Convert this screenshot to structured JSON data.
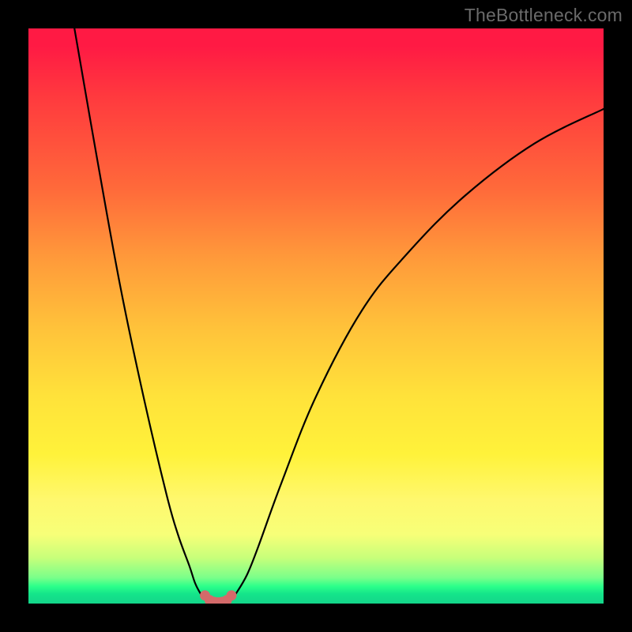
{
  "watermark": "TheBottleneck.com",
  "colors": {
    "frame": "#000000",
    "curve_stroke": "#000000",
    "marker_fill": "#d46a6a",
    "marker_stroke": "#d46a6a",
    "gradient_top": "#ff1a44",
    "gradient_bottom": "#14d58a"
  },
  "chart_data": {
    "type": "line",
    "title": "",
    "xlabel": "",
    "ylabel": "",
    "xlim": [
      0,
      100
    ],
    "ylim": [
      0,
      100
    ],
    "grid": false,
    "legend": false,
    "annotations": [
      "TheBottleneck.com"
    ],
    "series": [
      {
        "name": "left-branch",
        "x": [
          8,
          12,
          16,
          20,
          24,
          26,
          28,
          29,
          30,
          30.7
        ],
        "y": [
          100,
          77,
          55,
          36,
          19,
          12,
          6.5,
          3.5,
          1.6,
          0.7
        ]
      },
      {
        "name": "right-branch",
        "x": [
          35.3,
          36,
          38,
          40,
          44,
          50,
          58,
          66,
          76,
          88,
          100
        ],
        "y": [
          0.7,
          1.6,
          5,
          10,
          21,
          36,
          51,
          61,
          71,
          80,
          86
        ]
      },
      {
        "name": "valley-floor",
        "x": [
          30.7,
          31.3,
          32.0,
          32.7,
          33.3,
          34.0,
          34.7,
          35.3
        ],
        "y": [
          0.7,
          0.25,
          0.1,
          0.05,
          0.05,
          0.1,
          0.25,
          0.7
        ]
      }
    ],
    "markers": {
      "name": "valley-markers",
      "x": [
        30.7,
        31.5,
        32.3,
        33.0,
        33.7,
        34.5,
        35.3
      ],
      "y": [
        1.4,
        0.6,
        0.3,
        0.2,
        0.3,
        0.6,
        1.4
      ]
    }
  }
}
